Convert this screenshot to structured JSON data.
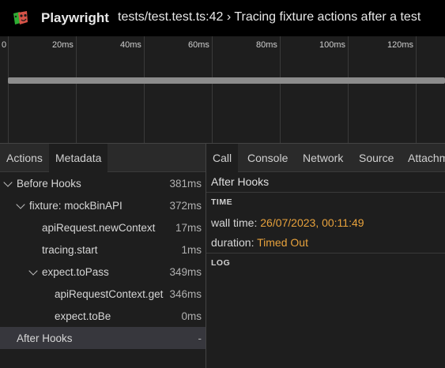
{
  "header": {
    "app_title": "Playwright",
    "test_title": "tests/test.test.ts:42 › Tracing fixture actions after a test"
  },
  "timeline": {
    "ticks": [
      "0",
      "20ms",
      "40ms",
      "60ms",
      "80ms",
      "100ms",
      "120ms"
    ]
  },
  "left_tabs": [
    "Actions",
    "Metadata"
  ],
  "actions": [
    {
      "label": "Before Hooks",
      "time": "381ms"
    },
    {
      "label": "fixture: mockBinAPI",
      "time": "372ms"
    },
    {
      "label": "apiRequest.newContext",
      "time": "17ms"
    },
    {
      "label": "tracing.start",
      "time": "1ms"
    },
    {
      "label": "expect.toPass",
      "time": "349ms"
    },
    {
      "label": "apiRequestContext.get",
      "time": "346ms"
    },
    {
      "label": "expect.toBe",
      "time": "0ms"
    },
    {
      "label": "After Hooks",
      "time": "-"
    }
  ],
  "right_tabs": [
    "Call",
    "Console",
    "Network",
    "Source",
    "Attachments"
  ],
  "call": {
    "title": "After Hooks",
    "time_section": "TIME",
    "wall_time_label": "wall time:",
    "wall_time_value": "26/07/2023, 00:11:49",
    "duration_label": "duration:",
    "duration_value": "Timed Out",
    "log_section": "LOG"
  },
  "colors": {
    "accent_value": "#e8a23c",
    "selected_row": "#37373d"
  }
}
